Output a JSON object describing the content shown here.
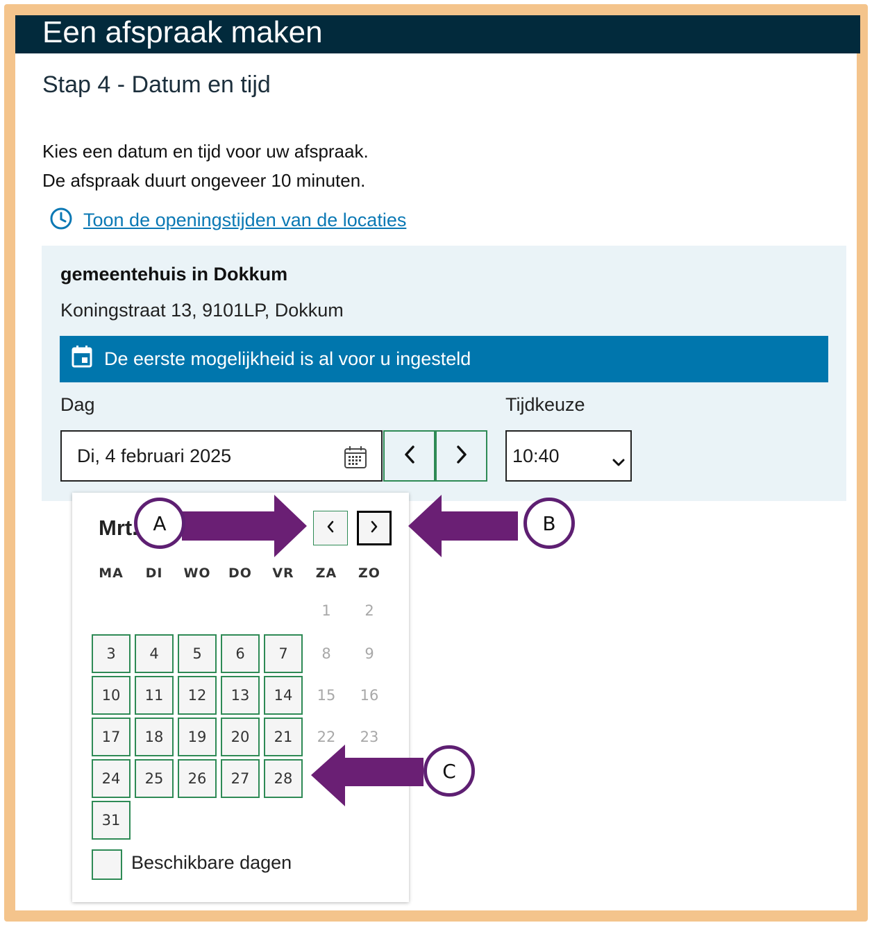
{
  "header": {
    "title": "Een afspraak maken"
  },
  "step": {
    "title": "Stap 4 - Datum en tijd"
  },
  "intro": {
    "line1": "Kies een datum en tijd voor uw afspraak.",
    "line2": "De afspraak duurt ongeveer 10 minuten."
  },
  "hours_link": {
    "label": "Toon de openingstijden van de locaties",
    "icon": "clock-icon"
  },
  "location": {
    "name": "gemeentehuis in Dokkum",
    "address": "Koningstraat 13, 9101LP, Dokkum",
    "notice": "De eerste mogelijkheid is al voor u ingesteld"
  },
  "form": {
    "day_label": "Dag",
    "day_value": "Di, 4 februari 2025",
    "time_label": "Tijdkeuze",
    "time_value": "10:40"
  },
  "calendar": {
    "title": "Mrt. 2025",
    "weekdays": [
      "MA",
      "DI",
      "WO",
      "DO",
      "VR",
      "ZA",
      "ZO"
    ],
    "weeks": [
      [
        null,
        null,
        null,
        null,
        null,
        {
          "d": "1",
          "s": "muted"
        },
        {
          "d": "2",
          "s": "muted"
        }
      ],
      [
        {
          "d": "3",
          "s": "avail"
        },
        {
          "d": "4",
          "s": "avail"
        },
        {
          "d": "5",
          "s": "avail"
        },
        {
          "d": "6",
          "s": "avail"
        },
        {
          "d": "7",
          "s": "avail"
        },
        {
          "d": "8",
          "s": "muted"
        },
        {
          "d": "9",
          "s": "muted"
        }
      ],
      [
        {
          "d": "10",
          "s": "avail"
        },
        {
          "d": "11",
          "s": "avail"
        },
        {
          "d": "12",
          "s": "avail"
        },
        {
          "d": "13",
          "s": "avail"
        },
        {
          "d": "14",
          "s": "avail"
        },
        {
          "d": "15",
          "s": "muted"
        },
        {
          "d": "16",
          "s": "muted"
        }
      ],
      [
        {
          "d": "17",
          "s": "avail"
        },
        {
          "d": "18",
          "s": "avail"
        },
        {
          "d": "19",
          "s": "avail"
        },
        {
          "d": "20",
          "s": "avail"
        },
        {
          "d": "21",
          "s": "avail"
        },
        {
          "d": "22",
          "s": "muted"
        },
        {
          "d": "23",
          "s": "muted"
        }
      ],
      [
        {
          "d": "24",
          "s": "avail"
        },
        {
          "d": "25",
          "s": "avail"
        },
        {
          "d": "26",
          "s": "avail"
        },
        {
          "d": "27",
          "s": "avail"
        },
        {
          "d": "28",
          "s": "avail"
        },
        null,
        null
      ],
      [
        {
          "d": "31",
          "s": "avail"
        },
        null,
        null,
        null,
        null,
        null,
        null
      ]
    ],
    "legend": "Beschikbare dagen"
  },
  "annotations": {
    "a": "A",
    "b": "B",
    "c": "C"
  },
  "colors": {
    "header_bg": "#022a3c",
    "accent_blue": "#0076ad",
    "link": "#0a78b4",
    "available_border": "#2e8a55",
    "location_bg": "#eaf3f7",
    "frame": "#f4c48c",
    "annotation": "#5e1f72"
  }
}
